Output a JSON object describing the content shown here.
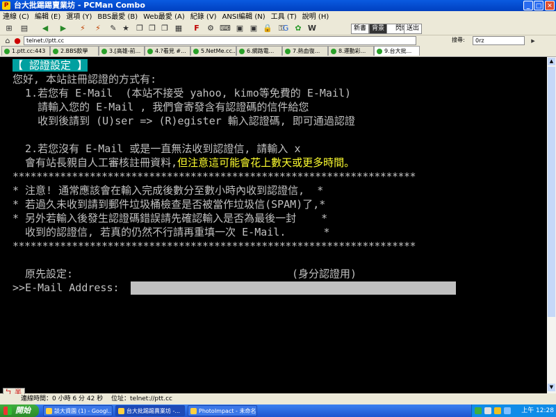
{
  "window": {
    "title": "台大批踢踢賣業坊 - PCMan Combo",
    "controls": {
      "minimize": "_",
      "maximize": "□",
      "close": "✕"
    }
  },
  "menu": [
    "連線 (C)",
    "編輯 (E)",
    "選項 (Y)",
    "BBS最愛 (B)",
    "Web最愛 (A)",
    "紀錄 (V)",
    "ANSI編輯 (N)",
    "工具 (T)",
    "說明 (H)"
  ],
  "toolbar": {
    "btn_new": "新書",
    "btn_wall": "背景",
    "chk_lock": "閃爍",
    "btn_send": "送出",
    "search_label": "搜尋:",
    "search_value": "0rz"
  },
  "address": {
    "value": "telnet://ptt.cc"
  },
  "tabs": [
    "1.ptt.cc:443",
    "2.BBS飲學",
    "3.[高雄-前...",
    "4.?看見 #...",
    "5.NetMe.cc...",
    "6.網路電...",
    "7.熱血復...",
    "8.運動彩...",
    "9.台大批..."
  ],
  "terminal": {
    "heading": "【 認證設定 】",
    "lines": [
      "您好, 本站註冊認證的方式有:",
      "  1.若您有 E-Mail  (本站不接受 yahoo, kimo等免費的 E-Mail)",
      "    請輸入您的 E-Mail , 我們會寄發含有認證碼的信件給您",
      "    收到後請到 (U)ser => (R)egister 輸入認證碼, 即可通過認證",
      "",
      "  2.若您沒有 E-Mail 或是一直無法收到認證信, 請輸入 x",
      "  會有站長親自人工審核註冊資料,"
    ],
    "warning_tail": "但注意這可能會花上數天或更多時間。",
    "stars": "********************************************************************",
    "notice": [
      "* 注意! 通常應該會在輸入完成後數分至數小時內收到認證信,  *",
      "* 若過久未收到請到郵件垃圾桶檢查是否被當作垃圾信(SPAM)了,*",
      "* 另外若輸入後發生認證碼錯誤請先確認輸入是否為最後一封    *",
      "  收到的認證信, 若真的仍然不行請再重填一次 E-Mail.      *"
    ],
    "original_label": "  原先設定:",
    "original_hint": "(身分認證用)",
    "prompt": ">>E-Mail Address:",
    "email_value": ""
  },
  "ime": {
    "left": "ㄅ",
    "right": "半"
  },
  "status": {
    "connected_time": "連線時間：0 小時 6 分 42 秒",
    "location": "位址：telnet://ptt.cc"
  },
  "taskbar": {
    "start": "開始",
    "tasks": [
      "談大資園 (1) - Googl...",
      "台大批踢踢賣業坊 -...",
      "PhotoImpact - 未命名..."
    ],
    "clock": "上午 12:28"
  },
  "colors": {
    "terminal_bg": "#000000",
    "heading_bg": "#00a0a0",
    "warning": "#ffff30"
  }
}
